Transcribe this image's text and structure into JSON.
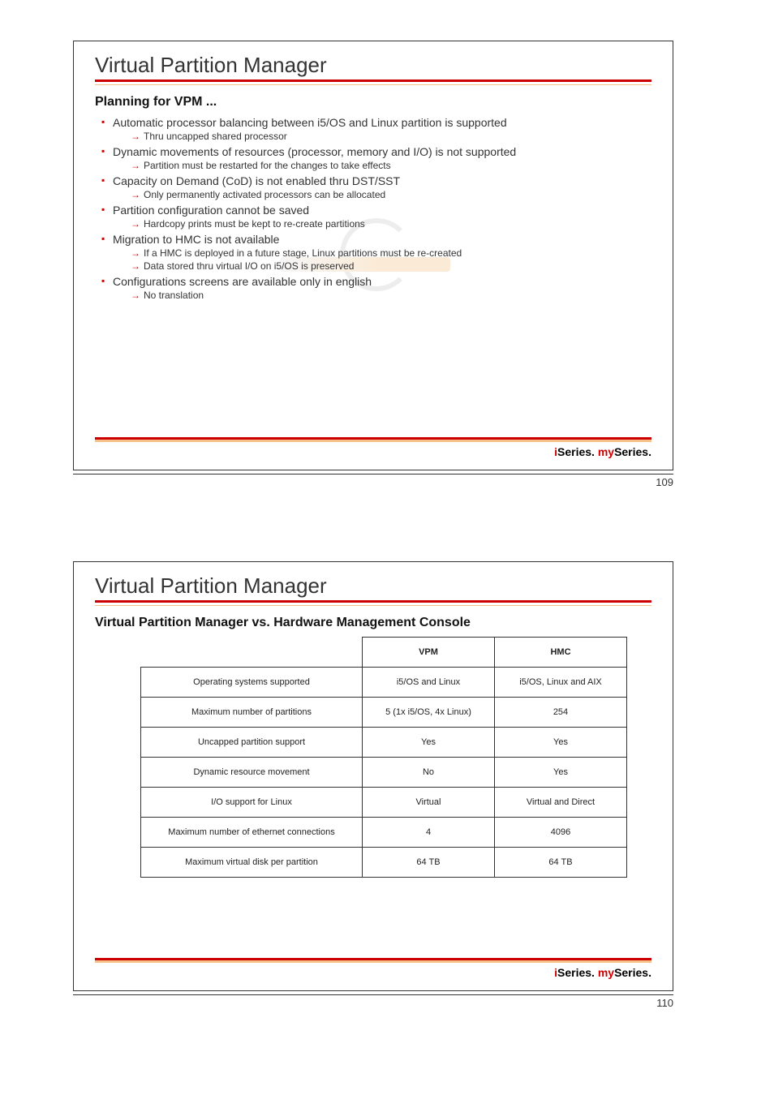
{
  "slide1": {
    "title": "Virtual Partition Manager",
    "subtitle": "Planning for VPM ...",
    "bullets": [
      {
        "text": "Automatic processor balancing between i5/OS and Linux partition is supported",
        "sub": [
          "Thru uncapped shared processor"
        ]
      },
      {
        "text": "Dynamic movements of resources (processor, memory and I/O) is not supported",
        "sub": [
          "Partition must be restarted for the changes to take effects"
        ]
      },
      {
        "text": "Capacity on Demand (CoD) is not enabled thru DST/SST",
        "sub": [
          "Only permanently activated processors can be allocated"
        ]
      },
      {
        "text": "Partition configuration cannot be saved",
        "sub": [
          "Hardcopy prints must be kept to re-create partitions"
        ]
      },
      {
        "text": "Migration to HMC is not available",
        "sub": [
          "If a HMC is deployed in a future stage, Linux partitions must be re-created",
          "Data stored thru virtual I/O on i5/OS is preserved"
        ]
      },
      {
        "text": "Configurations screens are available only in english",
        "sub": [
          "No translation"
        ]
      }
    ],
    "page_num": "109"
  },
  "slide2": {
    "title": "Virtual Partition Manager",
    "subtitle": "Virtual Partition Manager vs. Hardware Management Console",
    "table": {
      "headers": [
        "",
        "VPM",
        "HMC"
      ],
      "rows": [
        [
          "Operating systems supported",
          "i5/OS and Linux",
          "i5/OS, Linux and AIX"
        ],
        [
          "Maximum number of partitions",
          "5 (1x i5/OS, 4x Linux)",
          "254"
        ],
        [
          "Uncapped partition support",
          "Yes",
          "Yes"
        ],
        [
          "Dynamic resource movement",
          "No",
          "Yes"
        ],
        [
          "I/O support for Linux",
          "Virtual",
          "Virtual and Direct"
        ],
        [
          "Maximum number of ethernet connections",
          "4",
          "4096"
        ],
        [
          "Maximum virtual disk per partition",
          "64 TB",
          "64 TB"
        ]
      ]
    },
    "page_num": "110"
  },
  "branding": {
    "i": "i",
    "series1": "Series. ",
    "my": "my",
    "series2": "Series."
  }
}
